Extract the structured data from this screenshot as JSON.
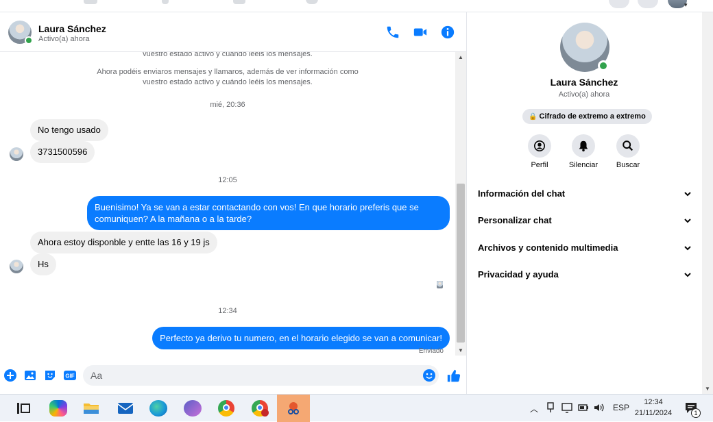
{
  "contact": {
    "name": "Laura Sánchez",
    "status": "Activo(a) ahora"
  },
  "header_icons": [
    "phone-icon",
    "video-icon",
    "info-icon"
  ],
  "conversation": {
    "system_top_partial": "vuestro estado activo y cuándo leéis los mensajes.",
    "system_line1": "Ahora podéis enviaros mensajes y llamaros, además de ver información como",
    "system_line2": "vuestro estado activo y cuándo leéis los mensajes.",
    "time1": "mié, 20:36",
    "msg_in_1": "No tengo usado",
    "msg_in_2": "3731500596",
    "time2": "12:05",
    "msg_out_1": "Buenisimo! Ya se van a estar contactando con vos! En que horario preferis que se comuniquen? A la mañana o a la tarde?",
    "msg_in_3": "Ahora estoy disponble y entte las 16 y 19 js",
    "msg_in_4": "Hs",
    "time3": "12:34",
    "msg_out_2": "Perfecto ya derivo tu numero, en el horario elegido se van a comunicar!",
    "sent_status": "Enviado"
  },
  "composer": {
    "placeholder": "Aa",
    "icons": [
      "plus-icon",
      "image-icon",
      "sticker-icon",
      "gif-icon",
      "emoji-icon",
      "like-icon"
    ],
    "gif_label": "GIF"
  },
  "sidebar": {
    "name": "Laura Sánchez",
    "status": "Activo(a) ahora",
    "encryption_label": "Cifrado de extremo a extremo",
    "actions": [
      {
        "label": "Perfil",
        "icon": "profile-icon"
      },
      {
        "label": "Silenciar",
        "icon": "bell-icon"
      },
      {
        "label": "Buscar",
        "icon": "search-icon"
      }
    ],
    "sections": [
      {
        "label": "Información del chat"
      },
      {
        "label": "Personalizar chat"
      },
      {
        "label": "Archivos y contenido multimedia"
      },
      {
        "label": "Privacidad y ayuda"
      }
    ]
  },
  "taskbar": {
    "language": "ESP",
    "time": "12:34",
    "date": "21/11/2024",
    "notification_count": "1",
    "apps": [
      "task-view-icon",
      "copilot-icon",
      "file-explorer-icon",
      "mail-icon",
      "edge-icon",
      "teams-icon",
      "chrome-icon",
      "chrome-profile-icon",
      "snipping-tool-icon"
    ]
  },
  "colors": {
    "accent": "#0a7cff",
    "online": "#31a24c"
  }
}
